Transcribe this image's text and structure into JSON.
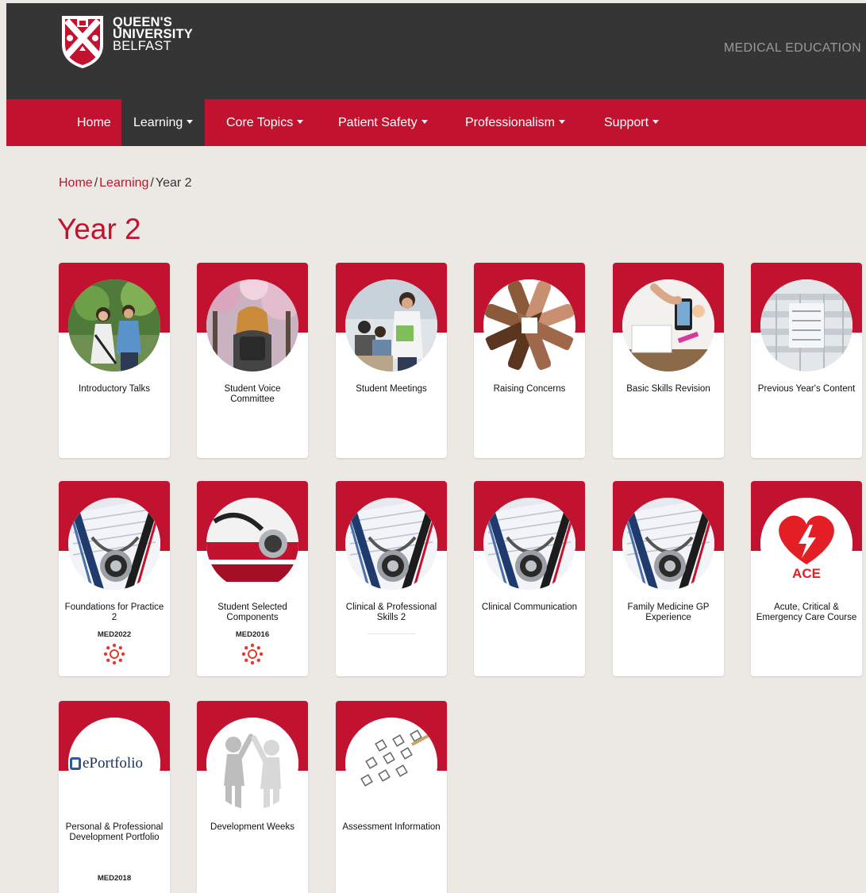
{
  "header": {
    "logo_lines": [
      "QUEEN'S",
      "UNIVERSITY",
      "BELFAST"
    ],
    "site_title": "MEDICAL EDUCATION"
  },
  "nav": {
    "items": [
      {
        "label": "Home",
        "dropdown": false,
        "active": false
      },
      {
        "label": "Learning",
        "dropdown": true,
        "active": true
      },
      {
        "label": "Core Topics",
        "dropdown": true,
        "active": false
      },
      {
        "label": "Patient Safety",
        "dropdown": true,
        "active": false
      },
      {
        "label": "Professionalism",
        "dropdown": true,
        "active": false
      },
      {
        "label": "Support",
        "dropdown": true,
        "active": false
      }
    ]
  },
  "breadcrumb": {
    "home": "Home",
    "learning": "Learning",
    "current": "Year 2",
    "separator": "/"
  },
  "page": {
    "title": "Year 2"
  },
  "cards": [
    {
      "title": "Introductory Talks",
      "image": "students-walking-photo"
    },
    {
      "title": "Student Voice Committee",
      "image": "student-under-blossom-photo"
    },
    {
      "title": "Student Meetings",
      "image": "students-in-class-photo"
    },
    {
      "title": "Raising Concerns",
      "image": "joined-hands-photo"
    },
    {
      "title": "Basic Skills Revision",
      "image": "desk-with-phone-photo"
    },
    {
      "title": "Previous Year's Content",
      "image": "library-atrium-photo"
    },
    {
      "title": "Foundations for Practice 2",
      "code": "MED2022",
      "image": "stethoscope-on-notes-photo",
      "canvas": true
    },
    {
      "title": "Student Selected Components",
      "code": "MED2016",
      "image": "stethoscope-on-books-photo",
      "canvas": true
    },
    {
      "title": "Clinical & Professional Skills 2",
      "image": "stethoscope-on-notes-photo"
    },
    {
      "title": "Clinical Communication",
      "image": "stethoscope-on-notes-photo"
    },
    {
      "title": "Family Medicine GP Experience",
      "image": "stethoscope-on-notes-photo"
    },
    {
      "title": "Acute, Critical & Emergency Care Course",
      "image": "ace-heart-logo",
      "logo_text": "ACE"
    },
    {
      "title": "Personal & Professional Development Portfolio",
      "code": "MED2018",
      "image": "eportfolio-logo",
      "logo_text": "ePortfolio"
    },
    {
      "title": "Development Weeks",
      "image": "figures-high-five"
    },
    {
      "title": "Assessment Information",
      "image": "answer-sheet-photo"
    }
  ],
  "colors": {
    "brand_red": "#c1122f",
    "dark_bar": "#353535",
    "page_bg": "#ece9e5"
  }
}
